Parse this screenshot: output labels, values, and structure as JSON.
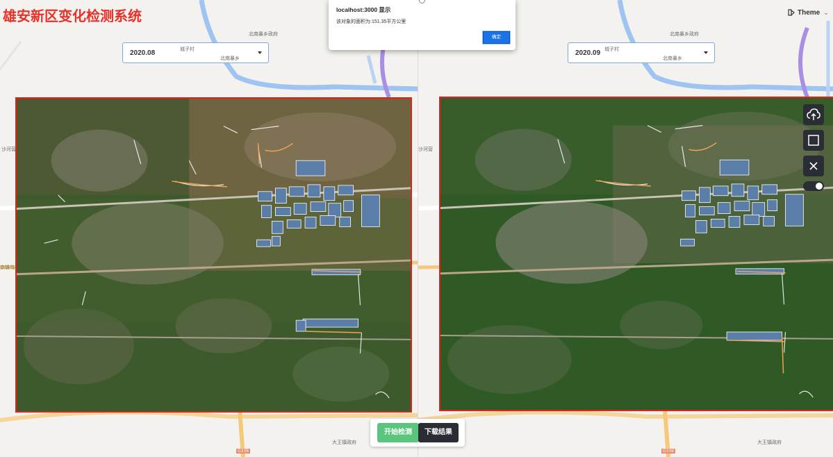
{
  "app": {
    "title": "雄安新区变化检测系统",
    "theme_label": "Theme"
  },
  "left_panel": {
    "date": "2020.08",
    "map_labels": [
      "北南暴乡政府",
      "城子村",
      "北南暴乡",
      "沙河营村",
      "京雄乌",
      "大王镇政府",
      "G336"
    ]
  },
  "right_panel": {
    "date": "2020.09",
    "map_labels": [
      "北南暴乡政府",
      "城子村",
      "北南暴乡",
      "沙河营",
      "大王镇政府",
      "G336"
    ]
  },
  "dialog": {
    "title": "localhost:3000 显示",
    "message": "该对象的面积为:151.35平方公里",
    "ok_label": "确定"
  },
  "toolbar": {
    "icons": [
      "upload-cloud-icon",
      "rectangle-select-icon",
      "close-icon"
    ],
    "toggle_state": "on"
  },
  "actions": {
    "start_label": "开始检测",
    "download_label": "下载结果"
  },
  "colors": {
    "title_red": "#e8312b",
    "frame_red": "#e0241b",
    "start_green": "#5ac57c",
    "dark": "#2b2d35",
    "accent_blue": "#1a73e8"
  }
}
